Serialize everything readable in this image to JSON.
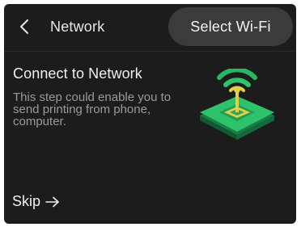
{
  "header": {
    "title": "Network",
    "select_wifi_label": "Select Wi-Fi"
  },
  "main": {
    "title": "Connect to Network",
    "description": "This step could enable you to send printing from phone, computer."
  },
  "footer": {
    "skip_label": "Skip"
  },
  "icons": {
    "back": "chevron-left-icon",
    "illustration": "wifi-printer-illustration",
    "skip": "arrow-right-icon"
  },
  "colors": {
    "background": "#1c1c1c",
    "button_bg": "#3b3b3b",
    "accent_green": "#27b85f",
    "accent_yellow": "#e4d04a",
    "text_primary": "#f0f0f0",
    "text_secondary": "#9a9a9a"
  }
}
